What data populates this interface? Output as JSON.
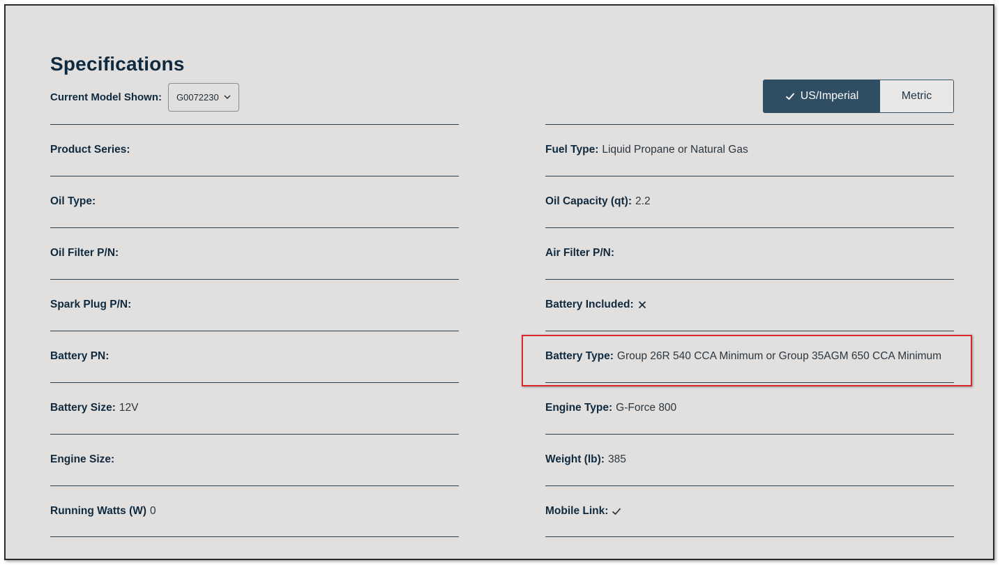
{
  "header": {
    "title": "Specifications",
    "model_label": "Current Model Shown:",
    "model_value": "G0072230"
  },
  "units": {
    "imperial_label": "US/Imperial",
    "metric_label": "Metric",
    "selected": "US/Imperial"
  },
  "specs_left": [
    {
      "label": "Product Series:",
      "value": ""
    },
    {
      "label": "Oil Type:",
      "value": ""
    },
    {
      "label": "Oil Filter P/N:",
      "value": ""
    },
    {
      "label": "Spark Plug P/N:",
      "value": ""
    },
    {
      "label": "Battery PN:",
      "value": ""
    },
    {
      "label": "Battery Size:",
      "value": "12V"
    },
    {
      "label": "Engine Size:",
      "value": ""
    },
    {
      "label": "Running Watts (W)",
      "value": "0"
    }
  ],
  "specs_right": [
    {
      "label": "Fuel Type:",
      "value": "Liquid Propane or Natural Gas"
    },
    {
      "label": "Oil Capacity (qt):",
      "value": "2.2"
    },
    {
      "label": "Air Filter P/N:",
      "value": ""
    },
    {
      "label": "Battery Included:",
      "value": "",
      "icon": "x-icon"
    },
    {
      "label": "Battery Type:",
      "value": "Group 26R 540 CCA Minimum or Group 35AGM 650 CCA Minimum",
      "highlighted": true
    },
    {
      "label": "Engine Type:",
      "value": "G-Force 800"
    },
    {
      "label": "Weight (lb):",
      "value": "385"
    },
    {
      "label": "Mobile Link:",
      "value": "",
      "icon": "checkmark-icon"
    }
  ],
  "colors": {
    "background": "#e2e0df",
    "primary": "#2f4d63",
    "heading": "#0f2a3f",
    "highlight_border": "#d9262b"
  }
}
